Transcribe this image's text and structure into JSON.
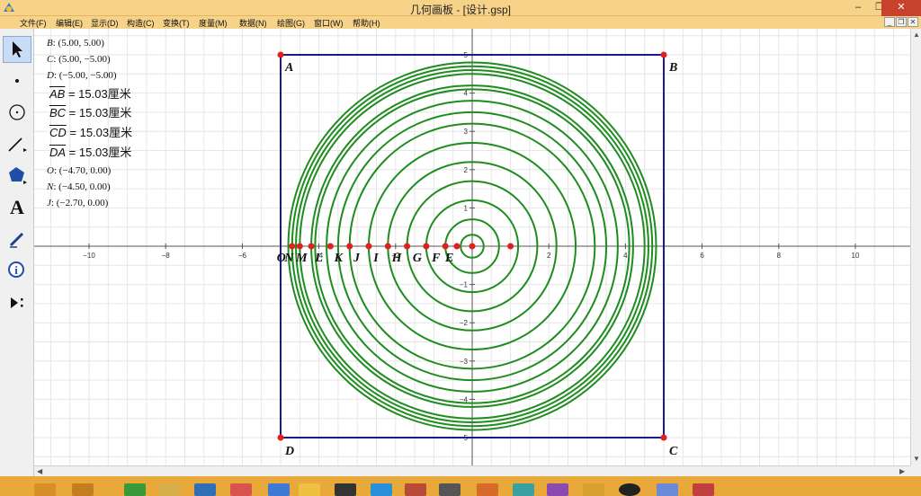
{
  "window": {
    "title": "几何画板 - [设计.gsp]",
    "controls": {
      "minimize": "–",
      "restore": "❐",
      "close": "✕"
    },
    "mdi_controls": {
      "minimize": "_",
      "restore": "❐",
      "close": "✕"
    }
  },
  "menu": [
    "文件(F)",
    "编辑(E)",
    "显示(D)",
    "构造(C)",
    "变换(T)",
    "度量(M)",
    "数据(N)",
    "绘图(G)",
    "窗口(W)",
    "帮助(H)"
  ],
  "toolbar": {
    "tools": [
      {
        "name": "selection-arrow-tool",
        "icon": "arrow-icon",
        "active": true
      },
      {
        "name": "point-tool",
        "icon": "point-icon"
      },
      {
        "name": "compass-tool",
        "icon": "circle-icon"
      },
      {
        "name": "straightedge-tool",
        "icon": "line-icon"
      },
      {
        "name": "polygon-tool",
        "icon": "pentagon-icon"
      },
      {
        "name": "text-tool",
        "icon": "letter-a-icon",
        "glyph": "A"
      },
      {
        "name": "marker-tool",
        "icon": "pen-icon"
      },
      {
        "name": "information-tool",
        "icon": "info-icon",
        "glyph": "i"
      },
      {
        "name": "custom-tools",
        "icon": "play-menu-icon"
      }
    ]
  },
  "measurements": {
    "coords_top": [
      {
        "label": "B",
        "value": ": (5.00, 5.00)"
      },
      {
        "label": "C",
        "value": ": (5.00, −5.00)"
      },
      {
        "label": "D",
        "value": ": (−5.00, −5.00)"
      }
    ],
    "lengths": [
      {
        "segment": "AB",
        "value": " = 15.03厘米"
      },
      {
        "segment": "BC",
        "value": " = 15.03厘米"
      },
      {
        "segment": "CD",
        "value": " = 15.03厘米"
      },
      {
        "segment": "DA",
        "value": " = 15.03厘米"
      }
    ],
    "coords_bottom": [
      {
        "label": "O",
        "value": ": (−4.70, 0.00)"
      },
      {
        "label": "N",
        "value": ": (−4.50, 0.00)"
      },
      {
        "label": "J",
        "value": ": (−2.70, 0.00)"
      }
    ]
  },
  "graph": {
    "x_ticks": [
      "-10",
      "-8",
      "-6",
      "-4",
      "-2",
      "2",
      "4",
      "6",
      "8",
      "10"
    ],
    "y_ticks": [
      "5",
      "4",
      "3",
      "2",
      "1",
      "-1",
      "-2",
      "-3",
      "-4",
      "-5"
    ],
    "x_range": [
      -11,
      11
    ],
    "y_range": [
      -5.5,
      5.5
    ],
    "square": {
      "corners": [
        {
          "name": "A",
          "x": -5,
          "y": 5
        },
        {
          "name": "B",
          "x": 5,
          "y": 5
        },
        {
          "name": "C",
          "x": 5,
          "y": -5
        },
        {
          "name": "D",
          "x": -5,
          "y": -5
        }
      ],
      "color": "#1a1a8c"
    },
    "circles": {
      "center": [
        0,
        0
      ],
      "radii": [
        0.3,
        0.7,
        1.2,
        1.7,
        2.2,
        2.7,
        3.2,
        3.5,
        3.8,
        4.1,
        4.2,
        4.5,
        4.6,
        4.7,
        4.8
      ],
      "color": "#1e8c1e"
    },
    "axis_points": [
      {
        "name": "E",
        "x": -0.4,
        "label_dx": -20
      },
      {
        "name": "F",
        "x": -0.7,
        "label_dx": -22
      },
      {
        "name": "G",
        "x": -1.2,
        "label_dx": -22
      },
      {
        "name": "H",
        "x": -1.7,
        "label_dx": -24
      },
      {
        "name": "I",
        "x": -2.2,
        "label_dx": -23
      },
      {
        "name": "J",
        "x": -2.7,
        "label_dx": -24
      },
      {
        "name": "K",
        "x": -3.2,
        "label_dx": -24
      },
      {
        "name": "L",
        "x": -3.7,
        "label_dx": -24
      },
      {
        "name": "M",
        "x": -4.2,
        "label_dx": -24
      },
      {
        "name": "N",
        "x": -4.5,
        "label_dx": -24
      },
      {
        "name": "O",
        "x": -4.7,
        "label_dx": -24
      },
      {
        "name": "",
        "x": 1.0,
        "label_dx": 0
      },
      {
        "name": "",
        "x": 0.0,
        "label_dx": 0
      }
    ],
    "point_color": "#e01f1f"
  },
  "colors": {
    "titlebar": "#f7d289",
    "taskbar": "#e8a93a",
    "grid": "#e6e6e6",
    "axis": "#555555"
  }
}
